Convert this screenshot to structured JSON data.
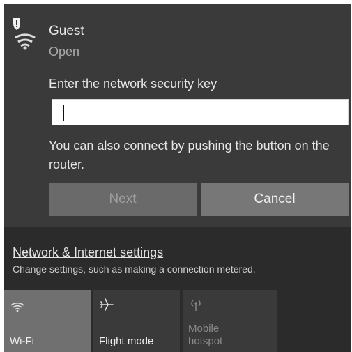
{
  "network": {
    "name": "Guest",
    "status": "Open"
  },
  "security": {
    "label": "Enter the network security key",
    "value": "",
    "hint": "You can also connect by pushing the button on the router."
  },
  "buttons": {
    "next": "Next",
    "cancel": "Cancel"
  },
  "settings": {
    "link": "Network & Internet settings",
    "description": "Change settings, such as making a connection metered."
  },
  "quick_actions": [
    {
      "label": "Wi-Fi",
      "icon": "wifi-icon",
      "active": true
    },
    {
      "label": "Flight mode",
      "icon": "airplane-icon",
      "active": false
    },
    {
      "label": "Mobile hotspot",
      "icon": "hotspot-icon",
      "active": false
    }
  ],
  "colors": {
    "panel": "#3a3a3a",
    "bottom": "#2b2b2b",
    "active_tile": "#707070",
    "input": "#ffffff"
  }
}
